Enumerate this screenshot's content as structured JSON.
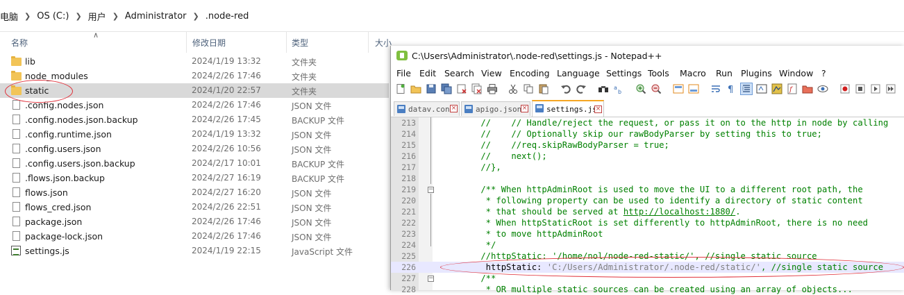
{
  "breadcrumb": {
    "items": [
      "电脑",
      "OS (C:)",
      "用户",
      "Administrator",
      ".node-red"
    ]
  },
  "columns": {
    "name": "名称",
    "modified": "修改日期",
    "type": "类型",
    "size": "大小"
  },
  "files": [
    {
      "name": "lib",
      "modified": "2024/1/19 13:32",
      "type": "文件夹",
      "icon": "folder-icon"
    },
    {
      "name": "node_modules",
      "modified": "2024/2/26 17:46",
      "type": "文件夹",
      "icon": "folder-icon"
    },
    {
      "name": "static",
      "modified": "2024/1/20 22:57",
      "type": "文件夹",
      "icon": "folder-icon",
      "selected": true
    },
    {
      "name": ".config.nodes.json",
      "modified": "2024/2/26 17:46",
      "type": "JSON 文件",
      "icon": "file-icon"
    },
    {
      "name": ".config.nodes.json.backup",
      "modified": "2024/2/26 17:45",
      "type": "BACKUP 文件",
      "icon": "file-icon"
    },
    {
      "name": ".config.runtime.json",
      "modified": "2024/1/19 13:32",
      "type": "JSON 文件",
      "icon": "file-icon"
    },
    {
      "name": ".config.users.json",
      "modified": "2024/2/26 10:56",
      "type": "JSON 文件",
      "icon": "file-icon"
    },
    {
      "name": ".config.users.json.backup",
      "modified": "2024/2/17 10:01",
      "type": "BACKUP 文件",
      "icon": "file-icon"
    },
    {
      "name": ".flows.json.backup",
      "modified": "2024/2/27 16:19",
      "type": "BACKUP 文件",
      "icon": "file-icon"
    },
    {
      "name": "flows.json",
      "modified": "2024/2/27 16:20",
      "type": "JSON 文件",
      "icon": "file-icon"
    },
    {
      "name": "flows_cred.json",
      "modified": "2024/2/26 22:51",
      "type": "JSON 文件",
      "icon": "file-icon"
    },
    {
      "name": "package.json",
      "modified": "2024/2/26 17:46",
      "type": "JSON 文件",
      "icon": "file-icon"
    },
    {
      "name": "package-lock.json",
      "modified": "2024/2/26 17:46",
      "type": "JSON 文件",
      "icon": "file-icon"
    },
    {
      "name": "settings.js",
      "modified": "2024/1/19 22:15",
      "type": "JavaScript 文件",
      "icon": "js-file-icon"
    }
  ],
  "notepad": {
    "title": "C:\\Users\\Administrator\\.node-red\\settings.js - Notepad++",
    "menu": [
      "File",
      "Edit",
      "Search",
      "View",
      "Encoding",
      "Language",
      "Settings",
      "Tools",
      "Macro",
      "Run",
      "Plugins",
      "Window",
      "?"
    ],
    "tabs": [
      {
        "label": "datav.conf"
      },
      {
        "label": "apigo.json"
      },
      {
        "label": "settings.js",
        "active": true
      }
    ],
    "lines": [
      {
        "n": "213",
        "text": "    //    // Handle/reject the request, or pass it on to the http in node by calling"
      },
      {
        "n": "214",
        "text": "    //    // Optionally skip our rawBodyParser by setting this to true;"
      },
      {
        "n": "215",
        "text": "    //    //req.skipRawBodyParser = true;"
      },
      {
        "n": "216",
        "text": "    //    next();"
      },
      {
        "n": "217",
        "text": "    //},"
      },
      {
        "n": "218",
        "text": ""
      },
      {
        "n": "219",
        "text": "    /** When httpAdminRoot is used to move the UI to a different root path, the"
      },
      {
        "n": "220",
        "text": "     * following property can be used to identify a directory of static content"
      },
      {
        "n": "221",
        "text_pre": "     * that should be served at ",
        "link": "http://localhost:1880/",
        "text_post": "."
      },
      {
        "n": "222",
        "text": "     * When httpStaticRoot is set differently to httpAdminRoot, there is no need"
      },
      {
        "n": "223",
        "text": "     * to move httpAdminRoot"
      },
      {
        "n": "224",
        "text": "     */"
      },
      {
        "n": "225",
        "text": "    //httpStatic: '/home/nol/node-red-static/', //single static source"
      },
      {
        "n": "226",
        "key": "     httpStatic: ",
        "value": "'C:/Users/Administrator/.node-red/static/'",
        "comment": ", //single static source"
      },
      {
        "n": "227",
        "text": "    /**"
      },
      {
        "n": "228",
        "text": "     * OR multiple static sources can be created using an array of objects..."
      }
    ]
  }
}
